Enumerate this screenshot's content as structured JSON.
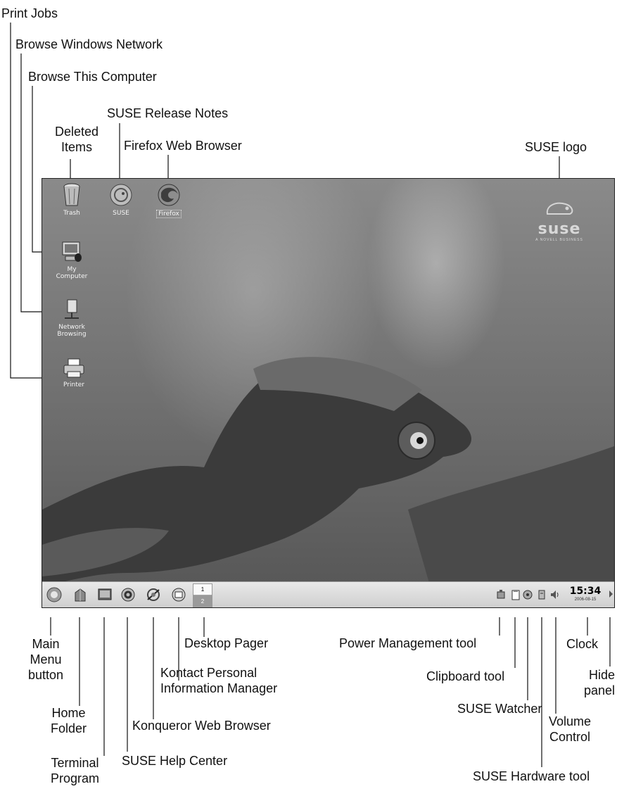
{
  "callouts": {
    "print_jobs": "Print Jobs",
    "browse_windows_network": "Browse Windows Network",
    "browse_this_computer": "Browse This Computer",
    "suse_release_notes": "SUSE Release Notes",
    "deleted_items": "Deleted\nItems",
    "firefox_web_browser": "Firefox Web Browser",
    "suse_logo": "SUSE logo",
    "main_menu_button": "Main\nMenu\nbutton",
    "home_folder": "Home\nFolder",
    "terminal_program": "Terminal\nProgram",
    "suse_help_center": "SUSE Help Center",
    "konqueror_web_browser": "Konqueror Web Browser",
    "kontact_pim": "Kontact Personal\nInformation Manager",
    "desktop_pager": "Desktop Pager",
    "power_management_tool": "Power Management tool",
    "clipboard_tool": "Clipboard tool",
    "suse_watcher": "SUSE Watcher",
    "volume_control": "Volume\nControl",
    "suse_hardware_tool": "SUSE Hardware tool",
    "clock": "Clock",
    "hide_panel": "Hide\npanel"
  },
  "desktop": {
    "icons": {
      "trash": "Trash",
      "suse": "SUSE",
      "firefox": "Firefox",
      "my_computer": "My\nComputer",
      "network_browsing": "Network\nBrowsing",
      "printer": "Printer"
    },
    "logo_text": "suse",
    "logo_subtext": "A NOVELL BUSINESS"
  },
  "panel": {
    "pager_desktops": [
      "1",
      "2"
    ],
    "clock_time": "15:34",
    "clock_date": "2006-08-15"
  }
}
